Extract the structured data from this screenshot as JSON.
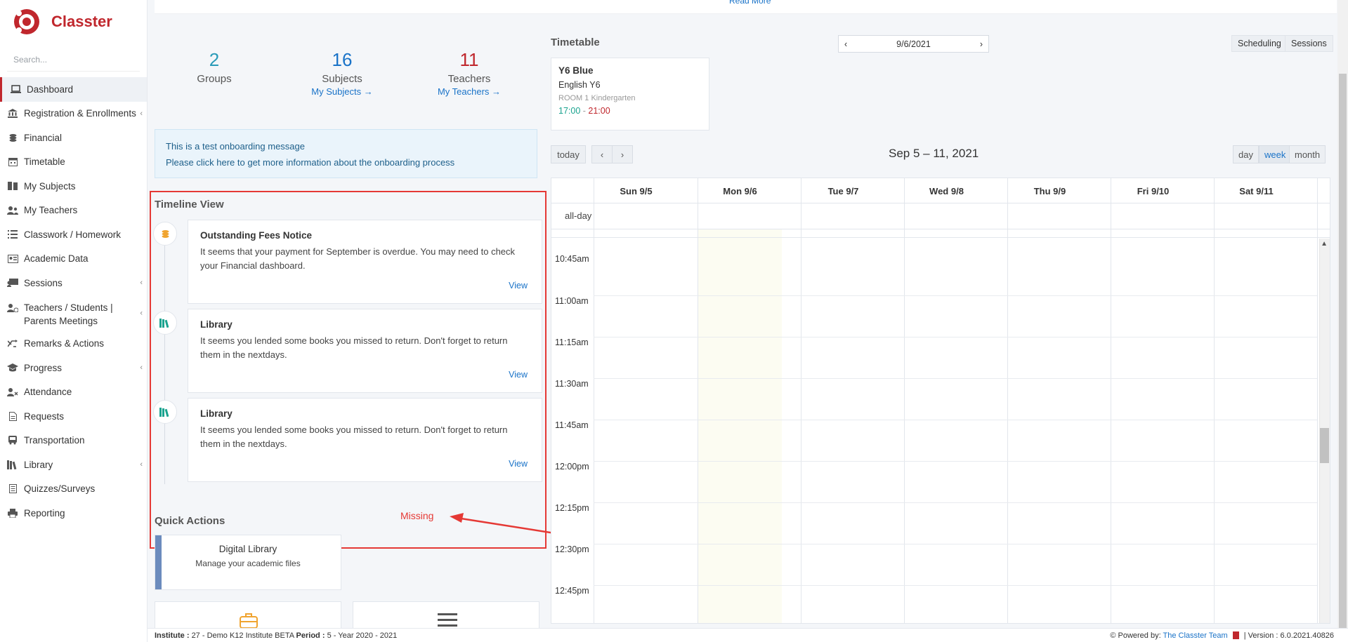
{
  "brand": {
    "name": "Classter",
    "color": "#c0272d"
  },
  "sidebar": {
    "search_placeholder": "Search...",
    "items": [
      {
        "label": "Dashboard",
        "icon": "laptop-icon"
      },
      {
        "label": "Registration & Enrollments",
        "icon": "bank-icon"
      },
      {
        "label": "Financial",
        "icon": "coins-icon"
      },
      {
        "label": "Timetable",
        "icon": "calendar-icon"
      },
      {
        "label": "My Subjects",
        "icon": "book-icon"
      },
      {
        "label": "My Teachers",
        "icon": "users-icon"
      },
      {
        "label": "Classwork / Homework",
        "icon": "list-icon"
      },
      {
        "label": "Academic Data",
        "icon": "id-card-icon"
      },
      {
        "label": "Sessions",
        "icon": "presentation-icon"
      },
      {
        "label": "Teachers / Students | Parents Meetings",
        "icon": "user-clock-icon"
      },
      {
        "label": "Remarks & Actions",
        "icon": "shuffle-icon"
      },
      {
        "label": "Progress",
        "icon": "graduation-cap-icon"
      },
      {
        "label": "Attendance",
        "icon": "user-x-icon"
      },
      {
        "label": "Requests",
        "icon": "document-icon"
      },
      {
        "label": "Transportation",
        "icon": "bus-icon"
      },
      {
        "label": "Library",
        "icon": "books-icon"
      },
      {
        "label": "Quizzes/Surveys",
        "icon": "checklist-icon"
      },
      {
        "label": "Reporting",
        "icon": "printer-icon"
      }
    ]
  },
  "readmore": "Read More",
  "stats": [
    {
      "value": "2",
      "label": "Groups",
      "color": "#2a9bb8"
    },
    {
      "value": "16",
      "label": "Subjects",
      "link": "My Subjects →",
      "color": "#1a73c8"
    },
    {
      "value": "11",
      "label": "Teachers",
      "link": "My Teachers →",
      "color": "#c0272d"
    }
  ],
  "onboarding": {
    "line1": "This is a test onboarding message",
    "line2": "Please click here to get more information about the onboarding process"
  },
  "timeline": {
    "title": "Timeline View",
    "items": [
      {
        "title": "Outstanding Fees Notice",
        "text": "It seems that your payment for September is overdue. You may need to check your Financial dashboard.",
        "link": "View",
        "icon": "coins-icon"
      },
      {
        "title": "Library",
        "text": "It seems you lended some books you missed to return. Don't forget to return them in the nextdays.",
        "link": "View",
        "icon": "books-icon"
      },
      {
        "title": "Library",
        "text": "It seems you lended some books you missed to return. Don't forget to return them in the nextdays.",
        "link": "View",
        "icon": "books-icon"
      }
    ]
  },
  "annotation": {
    "label": "Missing",
    "color": "#e53935"
  },
  "quick_actions": {
    "title": "Quick Actions",
    "cards": [
      {
        "title": "Digital Library",
        "subtitle": "Manage your academic files"
      }
    ]
  },
  "timetable": {
    "title": "Timetable",
    "date": "9/6/2021",
    "buttons": [
      "Scheduling",
      "Sessions"
    ],
    "card": {
      "class": "Y6 Blue",
      "subject": "English Y6",
      "room": "ROOM 1 Kindergarten",
      "start": "17:00",
      "sep": " - ",
      "end": "21:00"
    }
  },
  "calendar": {
    "today_label": "today",
    "range": "Sep 5 – 11, 2021",
    "views": [
      "day",
      "week",
      "month"
    ],
    "active_view": "week",
    "days": [
      "Sun 9/5",
      "Mon 9/6",
      "Tue 9/7",
      "Wed 9/8",
      "Thu 9/9",
      "Fri 9/10",
      "Sat 9/11"
    ],
    "allday_label": "all-day",
    "times": [
      "10:45am",
      "11:00am",
      "11:15am",
      "11:30am",
      "11:45am",
      "12:00pm",
      "12:15pm",
      "12:30pm",
      "12:45pm"
    ]
  },
  "footer": {
    "institute_label": "Institute :",
    "institute_value": "27 - Demo K12 Institute BETA",
    "period_label": "Period :",
    "period_value": "5 - Year 2020 - 2021",
    "powered_label": "Powered by:",
    "powered_link": "The Classter Team",
    "version": "| Version : 6.0.2021.40826"
  }
}
